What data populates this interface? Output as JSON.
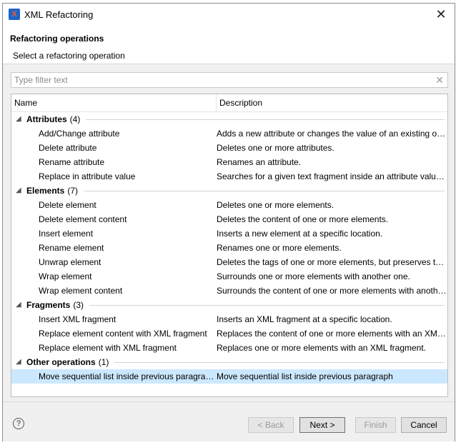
{
  "window": {
    "title": "XML Refactoring",
    "close_glyph": "✕",
    "app_icon": "oxygen-xml-icon"
  },
  "header": {
    "title": "Refactoring operations",
    "description": "Select a refactoring operation"
  },
  "filter": {
    "placeholder": "Type filter text",
    "value": "",
    "clear_glyph": "✕"
  },
  "table": {
    "columns": [
      "Name",
      "Description"
    ],
    "categories": [
      {
        "name": "Attributes",
        "count": "4",
        "items": [
          {
            "name": "Add/Change attribute",
            "description": "Adds a new attribute or changes the value of an existing one."
          },
          {
            "name": "Delete attribute",
            "description": "Deletes one or more attributes."
          },
          {
            "name": "Rename attribute",
            "description": "Renames an attribute."
          },
          {
            "name": "Replace in attribute value",
            "description": "Searches for a given text fragment inside an attribute value and..."
          }
        ]
      },
      {
        "name": "Elements",
        "count": "7",
        "items": [
          {
            "name": "Delete element",
            "description": "Deletes one or more elements."
          },
          {
            "name": "Delete element content",
            "description": "Deletes the content of one or more elements."
          },
          {
            "name": "Insert element",
            "description": "Inserts a new element at a specific location."
          },
          {
            "name": "Rename element",
            "description": "Renames one or more elements."
          },
          {
            "name": "Unwrap element",
            "description": "Deletes the tags of one or more elements, but preserves their c..."
          },
          {
            "name": "Wrap element",
            "description": "Surrounds one or more elements with another one."
          },
          {
            "name": "Wrap element content",
            "description": "Surrounds the content of one or more elements with another one."
          }
        ]
      },
      {
        "name": "Fragments",
        "count": "3",
        "items": [
          {
            "name": "Insert XML fragment",
            "description": "Inserts an XML fragment at a specific location."
          },
          {
            "name": "Replace element content with XML fragment",
            "description": "Replaces the content of one or more elements with an XML frag..."
          },
          {
            "name": "Replace element with XML fragment",
            "description": "Replaces one or more elements with an XML fragment."
          }
        ]
      },
      {
        "name": "Other operations",
        "count": "1",
        "items": [
          {
            "name": "Move sequential list inside previous paragraph",
            "description": "Move sequential list inside previous paragraph",
            "selected": true
          }
        ]
      }
    ],
    "expanded_glyph": "◢"
  },
  "footer": {
    "help_glyph": "?",
    "back_label": "< Back",
    "next_label": "Next >",
    "finish_label": "Finish",
    "cancel_label": "Cancel"
  },
  "colors": {
    "selection": "#cce8ff",
    "background": "#f0f0f0"
  }
}
